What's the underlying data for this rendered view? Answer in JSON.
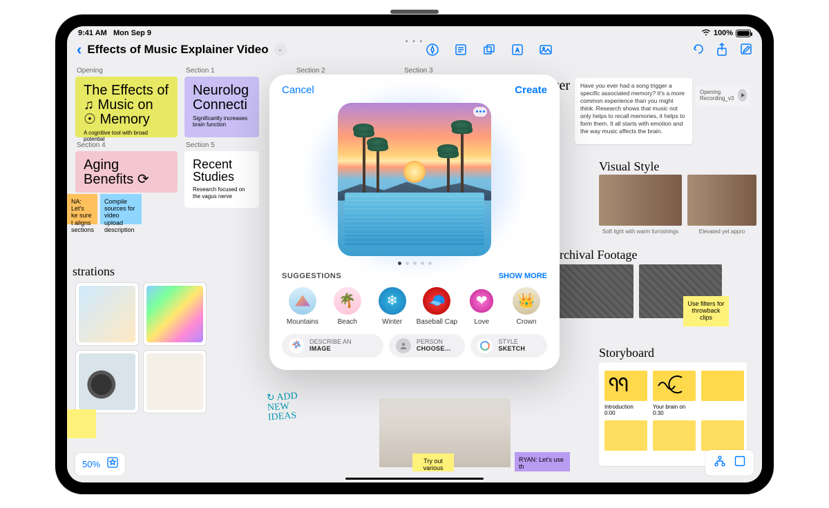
{
  "status": {
    "time": "9:41 AM",
    "date": "Mon Sep 9",
    "battery": "100%"
  },
  "doc": {
    "title": "Effects of Music Explainer Video"
  },
  "sections": [
    "Opening",
    "Section 1",
    "Section 2",
    "Section 3",
    "Section 4",
    "Section 5"
  ],
  "cards": {
    "opening": {
      "title": "The Effects of ♫ Music on ☉ Memory",
      "sub": "A cognitive tool with broad potential"
    },
    "s1": {
      "title": "Neurolog\nConnecti",
      "sub": "Significantly increases brain function"
    },
    "s4": {
      "title": "Aging Benefits ⟳",
      "sub": ""
    },
    "s5": {
      "title": "Recent Studies",
      "sub": "Research focused on the vagus nerve"
    },
    "over": "ver"
  },
  "stickies": {
    "na": "NA: Let's\nke sure\nt aligns\nsections",
    "compile": "Compile sources for video upload description",
    "filters": "Use filters for throwback clips",
    "tryout": "Try out various",
    "ryan": "RYAN: Let's use\nth"
  },
  "headings": {
    "illustrations": "strations",
    "visual": "Visual Style",
    "archival": "Archival Footage",
    "storyboard": "Storyboard"
  },
  "captions": {
    "vs1": "Soft light with warm furnishings",
    "vs2": "Elevated yet appro"
  },
  "body_text": {
    "memory": "Have you ever had a song trigger a specific associated memory? It's a more common experience than you might think. Research shows that music not only helps to recall memories, it helps to form them. It all starts with emotion and the way music affects the brain."
  },
  "attachment": {
    "name": "Opening Recording_v3"
  },
  "scribble": "ADD\nNEW\nIDEAS",
  "zoom": {
    "pct": "50%"
  },
  "sheet": {
    "cancel": "Cancel",
    "create": "Create",
    "suggestions_label": "SUGGESTIONS",
    "show_more": "SHOW MORE",
    "chips": [
      {
        "label": "Mountains"
      },
      {
        "label": "Beach"
      },
      {
        "label": "Winter"
      },
      {
        "label": "Baseball Cap"
      },
      {
        "label": "Love"
      },
      {
        "label": "Crown"
      }
    ],
    "prompts": {
      "describe": {
        "top": "DESCRIBE AN",
        "bottom": "IMAGE"
      },
      "person": {
        "top": "PERSON",
        "bottom": "CHOOSE…"
      },
      "style": {
        "top": "STYLE",
        "bottom": "SKETCH"
      }
    }
  },
  "storyboard": {
    "intro_label": "Introduction",
    "intro_time": "0:00",
    "brain_label": "Your brain on",
    "brain_time": "0:30"
  }
}
